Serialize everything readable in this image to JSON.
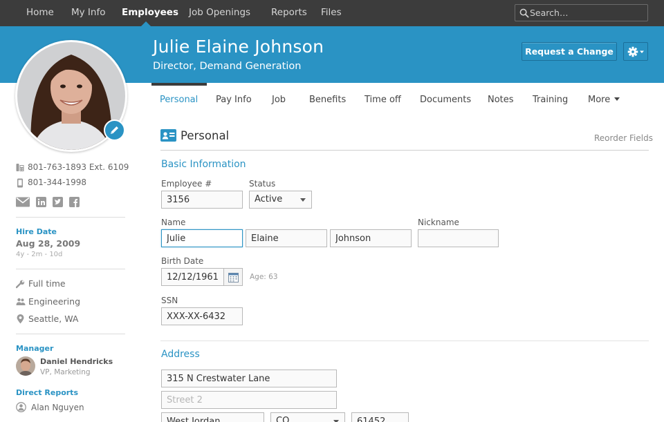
{
  "nav": {
    "items": [
      "Home",
      "My Info",
      "Employees",
      "Job Openings",
      "Reports",
      "Files"
    ],
    "active": "Employees",
    "search_placeholder": "Search…"
  },
  "header": {
    "name": "Julie Elaine Johnson",
    "title": "Director, Demand Generation",
    "request_change": "Request a Change"
  },
  "sidebar": {
    "work_phone": "801-763-1893  Ext. 6109",
    "mobile_phone": "801-344-1998",
    "hire_date_label": "Hire Date",
    "hire_date": "Aug 28, 2009",
    "tenure": "4y - 2m - 10d",
    "employment_type": "Full time",
    "department": "Engineering",
    "location": "Seattle, WA",
    "manager_label": "Manager",
    "manager_name": "Daniel Hendricks",
    "manager_title": "VP, Marketing",
    "direct_reports_label": "Direct Reports",
    "direct_reports": [
      "Alan Nguyen"
    ]
  },
  "tabs": [
    "Personal",
    "Pay Info",
    "Job",
    "Benefits",
    "Time off",
    "Documents",
    "Notes",
    "Training",
    "More"
  ],
  "active_tab": "Personal",
  "section": {
    "title": "Personal",
    "reorder": "Reorder Fields"
  },
  "basic": {
    "title": "Basic Information",
    "employee_no_label": "Employee #",
    "employee_no": "3156",
    "status_label": "Status",
    "status": "Active",
    "name_label": "Name",
    "first_name": "Julie",
    "middle_name": "Elaine",
    "last_name": "Johnson",
    "nickname_label": "Nickname",
    "nickname": "",
    "birth_date_label": "Birth Date",
    "birth_date": "12/12/1961",
    "age": "Age: 63",
    "ssn_label": "SSN",
    "ssn": "XXX-XX-6432"
  },
  "address": {
    "title": "Address",
    "street1": "315 N Crestwater Lane",
    "street2_placeholder": "Street 2",
    "city": "West Jordan",
    "state": "CO",
    "zip": "61452"
  },
  "colors": {
    "nav_bg": "#3c3c3c",
    "brand_blue": "#2a93c4",
    "divider": "#dcdcdc"
  },
  "icons": [
    "search-icon",
    "gear-icon",
    "pencil-icon",
    "office-phone-icon",
    "mobile-phone-icon",
    "email-icon",
    "linkedin-icon",
    "twitter-icon",
    "facebook-icon",
    "wrench-icon",
    "people-icon",
    "location-pin-icon",
    "person-icon",
    "id-card-icon",
    "calendar-icon",
    "chevron-down-icon"
  ]
}
